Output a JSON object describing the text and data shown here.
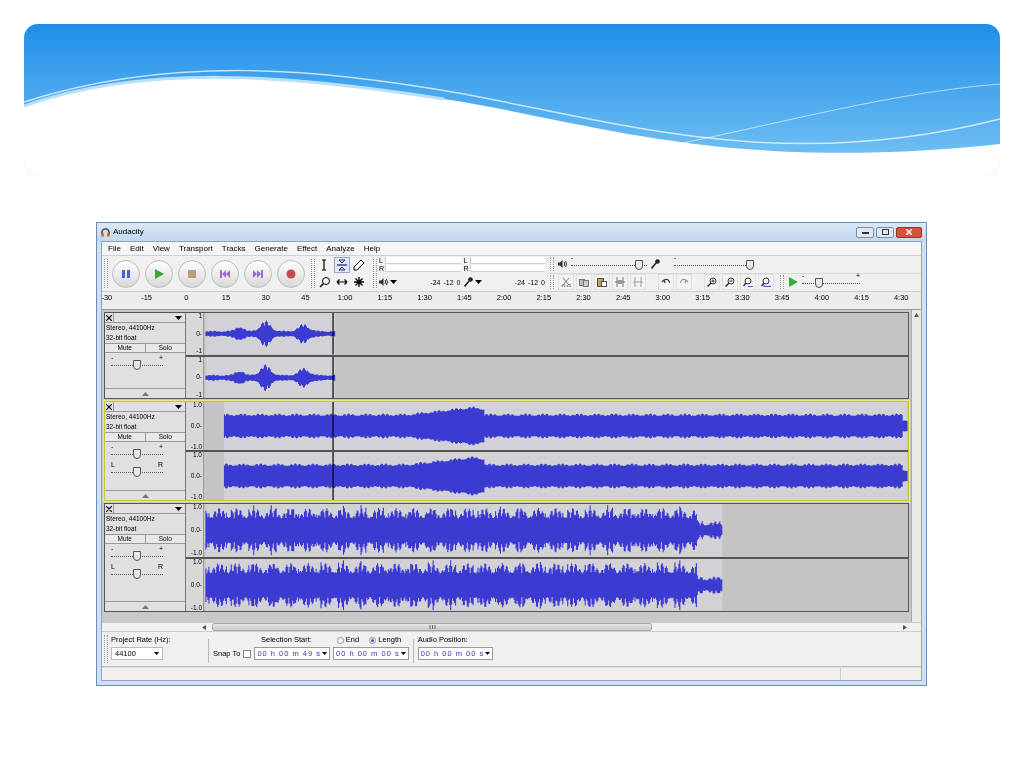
{
  "window": {
    "title": "Audacity"
  },
  "menu": [
    "File",
    "Edit",
    "View",
    "Transport",
    "Tracks",
    "Generate",
    "Effect",
    "Analyze",
    "Help"
  ],
  "meters": {
    "play_channels": [
      "L",
      "R"
    ],
    "record_channels": [
      "L",
      "R"
    ],
    "play_scale": [
      "-24",
      "-12",
      "0"
    ],
    "record_scale": [
      "-24",
      "-12",
      "0"
    ]
  },
  "mixer": {
    "playback": {
      "minus": "-",
      "level": 0.9
    },
    "recording": {
      "minus": "-",
      "level": 1.0
    }
  },
  "play_at_speed": {
    "minus": "-",
    "plus": "+",
    "level": 0.3
  },
  "ruler": [
    "-30",
    "-15",
    "0",
    "15",
    "30",
    "45",
    "1:00",
    "1:15",
    "1:30",
    "1:45",
    "2:00",
    "2:15",
    "2:30",
    "2:45",
    "3:00",
    "3:15",
    "3:30",
    "3:45",
    "4:00",
    "4:15",
    "4:30"
  ],
  "tracks": [
    {
      "format": "Stereo, 44100Hz",
      "sample": "32-bit float",
      "mute": "Mute",
      "solo": "Solo",
      "selected": false,
      "gain": {
        "minus": "-",
        "plus": "+",
        "level": 0.5
      },
      "channels": [
        {
          "scale": [
            "1",
            "0-",
            "-1"
          ]
        },
        {
          "scale": [
            "1",
            "0-",
            "-1"
          ]
        }
      ]
    },
    {
      "format": "Stereo, 44100Hz",
      "sample": "32-bit float",
      "mute": "Mute",
      "solo": "Solo",
      "selected": true,
      "gain": {
        "minus": "-",
        "plus": "+",
        "level": 0.5
      },
      "pan": {
        "left": "L",
        "right": "R",
        "level": 0.5
      },
      "channels": [
        {
          "scale": [
            "1.0",
            "0.0-",
            "-1.0"
          ]
        },
        {
          "scale": [
            "1.0",
            "0.0-",
            "-1.0"
          ]
        }
      ]
    },
    {
      "format": "Stereo, 44100Hz",
      "sample": "32-bit float",
      "mute": "Mute",
      "solo": "Solo",
      "selected": false,
      "gain": {
        "minus": "-",
        "plus": "+",
        "level": 0.5
      },
      "pan": {
        "left": "L",
        "right": "R",
        "level": 0.5
      },
      "channels": [
        {
          "scale": [
            "1.0",
            "0.0-",
            "-1.0"
          ]
        },
        {
          "scale": [
            "1.0",
            "0.0-",
            "-1.0"
          ]
        }
      ]
    }
  ],
  "selection_bar": {
    "rate_label": "Project Rate (Hz):",
    "rate": "44100",
    "snap_label": "Snap To",
    "snap_checked": false,
    "start_label": "Selection Start:",
    "start": "00 h 00 m 49 s",
    "end_label": "End",
    "end_selected": false,
    "length_label": "Length",
    "length_selected": true,
    "length": "00 h 00 m 00 s",
    "position_label": "Audio Position:",
    "position": "00 h 00 m 00 s"
  }
}
